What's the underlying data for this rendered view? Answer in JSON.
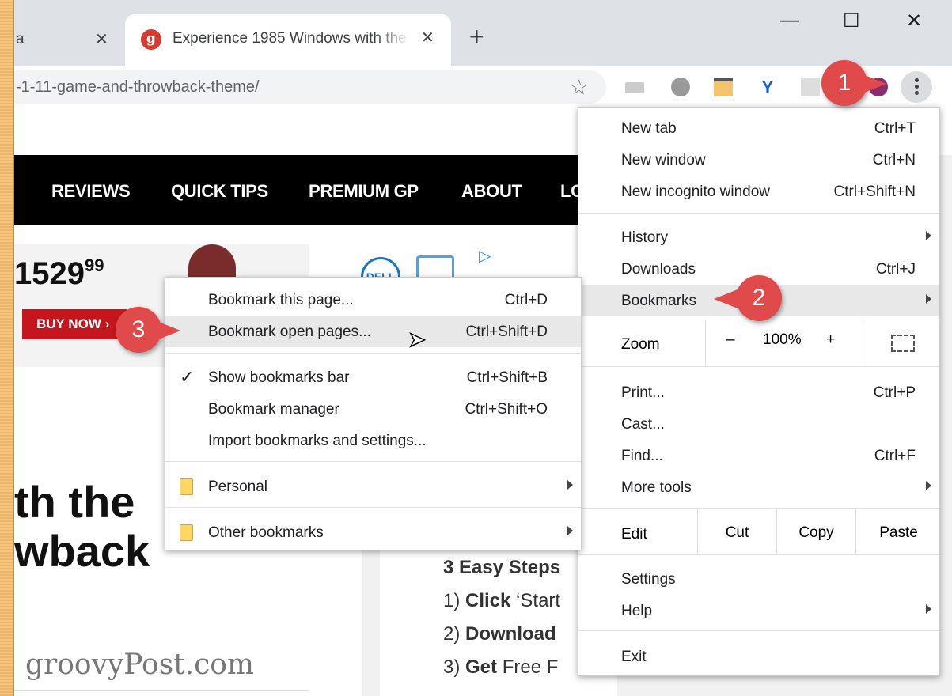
{
  "tabs": [
    {
      "title": "a",
      "active": false
    },
    {
      "title": "Experience 1985 Windows with the",
      "active": true
    }
  ],
  "toolbar": {
    "url": "-1-11-game-and-throwback-theme/"
  },
  "window_controls": {
    "minimize": "—",
    "maximize": "☐",
    "close": "✕"
  },
  "site": {
    "nav": [
      "REVIEWS",
      "QUICK TIPS",
      "PREMIUM GP",
      "ABOUT",
      "LO"
    ],
    "ad": {
      "price": "1529",
      "cents": "99",
      "cta": "BUY NOW ›",
      "brand": "DELL"
    },
    "headline": [
      "th the",
      "wback"
    ],
    "brand": "groovyPost.com",
    "steps_title": "3 Easy Steps",
    "steps": [
      {
        "num": "1)",
        "bold": "Click",
        "rest": " ‘Start"
      },
      {
        "num": "2)",
        "bold": "Download",
        "rest": ""
      },
      {
        "num": "3)",
        "bold": "Get",
        "rest": " Free F"
      }
    ]
  },
  "main_menu": {
    "items": [
      {
        "label": "New tab",
        "shortcut": "Ctrl+T"
      },
      {
        "label": "New window",
        "shortcut": "Ctrl+N"
      },
      {
        "label": "New incognito window",
        "shortcut": "Ctrl+Shift+N"
      },
      {
        "label": "History",
        "shortcut": ""
      },
      {
        "label": "Downloads",
        "shortcut": "Ctrl+J"
      },
      {
        "label": "Bookmarks",
        "shortcut": ""
      },
      {
        "label": "Print...",
        "shortcut": "Ctrl+P"
      },
      {
        "label": "Cast...",
        "shortcut": ""
      },
      {
        "label": "Find...",
        "shortcut": "Ctrl+F"
      },
      {
        "label": "More tools",
        "shortcut": ""
      },
      {
        "label": "Settings",
        "shortcut": ""
      },
      {
        "label": "Help",
        "shortcut": ""
      },
      {
        "label": "Exit",
        "shortcut": ""
      }
    ],
    "zoom": {
      "label": "Zoom",
      "minus": "–",
      "value": "100%",
      "plus": "+"
    },
    "edit": {
      "label": "Edit",
      "cut": "Cut",
      "copy": "Copy",
      "paste": "Paste"
    }
  },
  "bookmarks_menu": {
    "items": [
      {
        "label": "Bookmark this page...",
        "shortcut": "Ctrl+D"
      },
      {
        "label": "Bookmark open pages...",
        "shortcut": "Ctrl+Shift+D"
      },
      {
        "label": "Show bookmarks bar",
        "shortcut": "Ctrl+Shift+B",
        "checked": true
      },
      {
        "label": "Bookmark manager",
        "shortcut": "Ctrl+Shift+O"
      },
      {
        "label": "Import bookmarks and settings...",
        "shortcut": ""
      },
      {
        "label": "Personal",
        "shortcut": ""
      },
      {
        "label": "Other bookmarks",
        "shortcut": ""
      }
    ]
  },
  "callouts": [
    "1",
    "2",
    "3"
  ],
  "colors": {
    "callout": "#e04a4a",
    "highlight": "#e8e8e8",
    "folder": "#fdd663"
  }
}
